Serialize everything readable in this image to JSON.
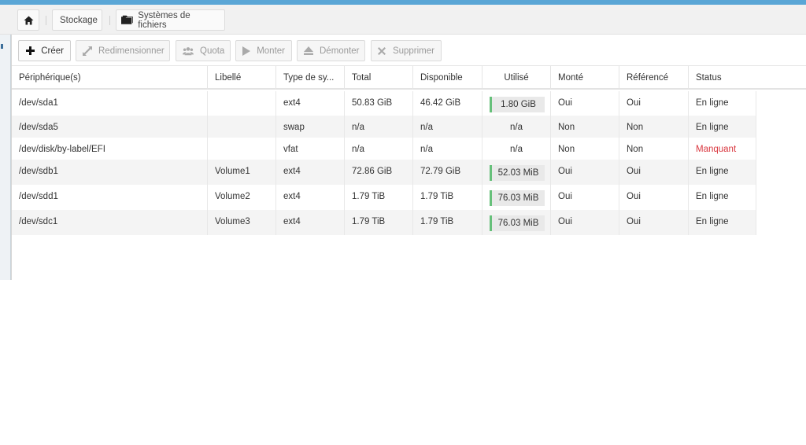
{
  "breadcrumb": {
    "home_icon": "home-icon",
    "storage_label": "Stockage",
    "filesystems_label": "Systèmes de fichiers",
    "filesystems_icon": "folder-icon"
  },
  "toolbar": {
    "create": {
      "label": "Créer",
      "icon": "plus-icon"
    },
    "resize": {
      "label": "Redimensionner",
      "icon": "resize-icon"
    },
    "quota": {
      "label": "Quota",
      "icon": "users-icon"
    },
    "mount": {
      "label": "Monter",
      "icon": "play-icon"
    },
    "unmount": {
      "label": "Démonter",
      "icon": "eject-icon"
    },
    "delete": {
      "label": "Supprimer",
      "icon": "close-icon"
    }
  },
  "table": {
    "headers": {
      "device": "Périphérique(s)",
      "label": "Libellé",
      "type": "Type de sy...",
      "total": "Total",
      "available": "Disponible",
      "used": "Utilisé",
      "mounted": "Monté",
      "referenced": "Référencé",
      "status": "Status"
    },
    "rows": [
      {
        "device": "/dev/sda1",
        "label": "",
        "type": "ext4",
        "total": "50.83 GiB",
        "available": "46.42 GiB",
        "used": "1.80 GiB",
        "mounted": "Oui",
        "referenced": "Oui",
        "status": "En ligne"
      },
      {
        "device": "/dev/sda5",
        "label": "",
        "type": "swap",
        "total": "n/a",
        "available": "n/a",
        "used": "n/a",
        "mounted": "Non",
        "referenced": "Non",
        "status": "En ligne"
      },
      {
        "device": "/dev/disk/by-label/EFI",
        "label": "",
        "type": "vfat",
        "total": "n/a",
        "available": "n/a",
        "used": "n/a",
        "mounted": "Non",
        "referenced": "Non",
        "status": "Manquant"
      },
      {
        "device": "/dev/sdb1",
        "label": "Volume1",
        "type": "ext4",
        "total": "72.86 GiB",
        "available": "72.79 GiB",
        "used": "52.03 MiB",
        "mounted": "Oui",
        "referenced": "Oui",
        "status": "En ligne"
      },
      {
        "device": "/dev/sdd1",
        "label": "Volume2",
        "type": "ext4",
        "total": "1.79 TiB",
        "available": "1.79 TiB",
        "used": "76.03 MiB",
        "mounted": "Oui",
        "referenced": "Oui",
        "status": "En ligne"
      },
      {
        "device": "/dev/sdc1",
        "label": "Volume3",
        "type": "ext4",
        "total": "1.79 TiB",
        "available": "1.79 TiB",
        "used": "76.03 MiB",
        "mounted": "Oui",
        "referenced": "Oui",
        "status": "En ligne"
      }
    ]
  },
  "colors": {
    "accent": "#5aa6d6",
    "usage_bar": "#66c07a",
    "status_missing": "#d9363e"
  }
}
